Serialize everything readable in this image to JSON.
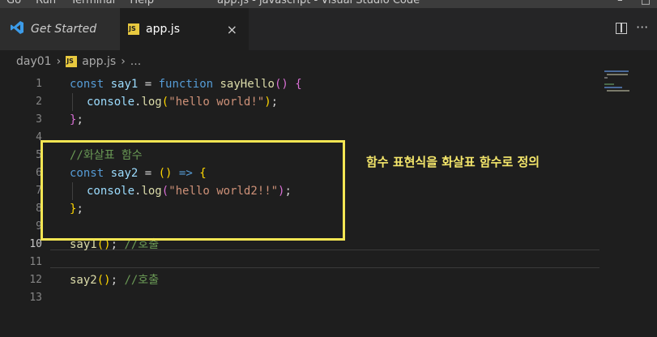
{
  "window": {
    "menu": [
      "Go",
      "Run",
      "Terminal",
      "Help"
    ],
    "title": "app.js - javascript - Visual Studio Code"
  },
  "tabs": [
    {
      "label": "Get Started",
      "icon": "vscode-logo-icon",
      "active": false
    },
    {
      "label": "app.js",
      "icon": "js-file-icon",
      "active": true,
      "close": "×"
    }
  ],
  "breadcrumb": {
    "folder": "day01",
    "file": "app.js",
    "more": "..."
  },
  "code_lines": [
    {
      "n": "1"
    },
    {
      "n": "2"
    },
    {
      "n": "3"
    },
    {
      "n": "4"
    },
    {
      "n": "5"
    },
    {
      "n": "6"
    },
    {
      "n": "7"
    },
    {
      "n": "8"
    },
    {
      "n": "9"
    },
    {
      "n": "10"
    },
    {
      "n": "11"
    },
    {
      "n": "12"
    },
    {
      "n": "13"
    }
  ],
  "code": {
    "l1": {
      "kw": "const",
      "var": "say1",
      "eq": "=",
      "kw2": "function",
      "fn": "sayHello",
      "paren": "()",
      "brace": "{"
    },
    "l2": {
      "obj": "console",
      "dot": ".",
      "fn": "log",
      "open": "(",
      "str": "\"hello world!\"",
      "close": ")",
      "semi": ";"
    },
    "l3": {
      "brace": "}",
      "semi": ";"
    },
    "l5": {
      "comment": "//화살표 함수"
    },
    "l6": {
      "kw": "const",
      "var": "say2",
      "eq": "=",
      "paren": "()",
      "arrow": "=>",
      "brace": "{"
    },
    "l7": {
      "obj": "console",
      "dot": ".",
      "fn": "log",
      "open": "(",
      "str": "\"hello world2!!\"",
      "close": ")",
      "semi": ";"
    },
    "l8": {
      "brace": "}",
      "semi": ";"
    },
    "l10": {
      "fn": "say1",
      "paren": "()",
      "semi": ";",
      "comment": "//호출"
    },
    "l12": {
      "fn": "say2",
      "paren": "()",
      "semi": ";",
      "comment": "//호출"
    }
  },
  "annotation": "함수 표현식을 화살표 함수로 정의",
  "colors": {
    "accent_box": "#f4e653",
    "annotation": "#f5e76b",
    "editor_bg": "#1e1e1e"
  }
}
